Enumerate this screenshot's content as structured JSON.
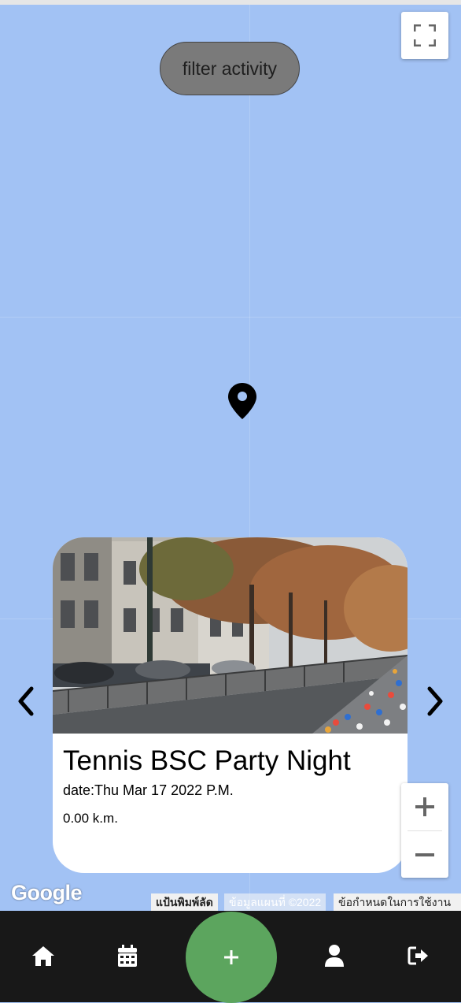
{
  "map": {
    "filter_label": "filter activity",
    "fullscreen_icon": "fullscreen-icon",
    "pin_icon": "map-pin-icon",
    "google_logo": "Google",
    "attribution": {
      "keyboard_shortcuts": "แป้นพิมพ์ลัด",
      "map_data": "ข้อมูลแผนที่ ©2022",
      "terms": "ข้อกำหนดในการใช้งาน"
    },
    "zoom_in_icon": "plus-icon",
    "zoom_out_icon": "minus-icon"
  },
  "carousel": {
    "prev_icon": "chevron-left-icon",
    "next_icon": "chevron-right-icon",
    "card": {
      "title": "Tennis BSC Party Night",
      "date": "date:Thu Mar 17 2022 P.M.",
      "distance": "0.00 k.m.",
      "image": "street-marathon-photo"
    }
  },
  "navbar": {
    "items": [
      {
        "icon": "home-icon"
      },
      {
        "icon": "calendar-icon"
      },
      {
        "icon": "plus-icon"
      },
      {
        "icon": "user-icon"
      },
      {
        "icon": "logout-icon"
      }
    ],
    "add_color": "#5ca55e",
    "background": "#181818"
  },
  "colors": {
    "map_background": "#a2c2f4",
    "filter_button": "#7a7a7a"
  }
}
